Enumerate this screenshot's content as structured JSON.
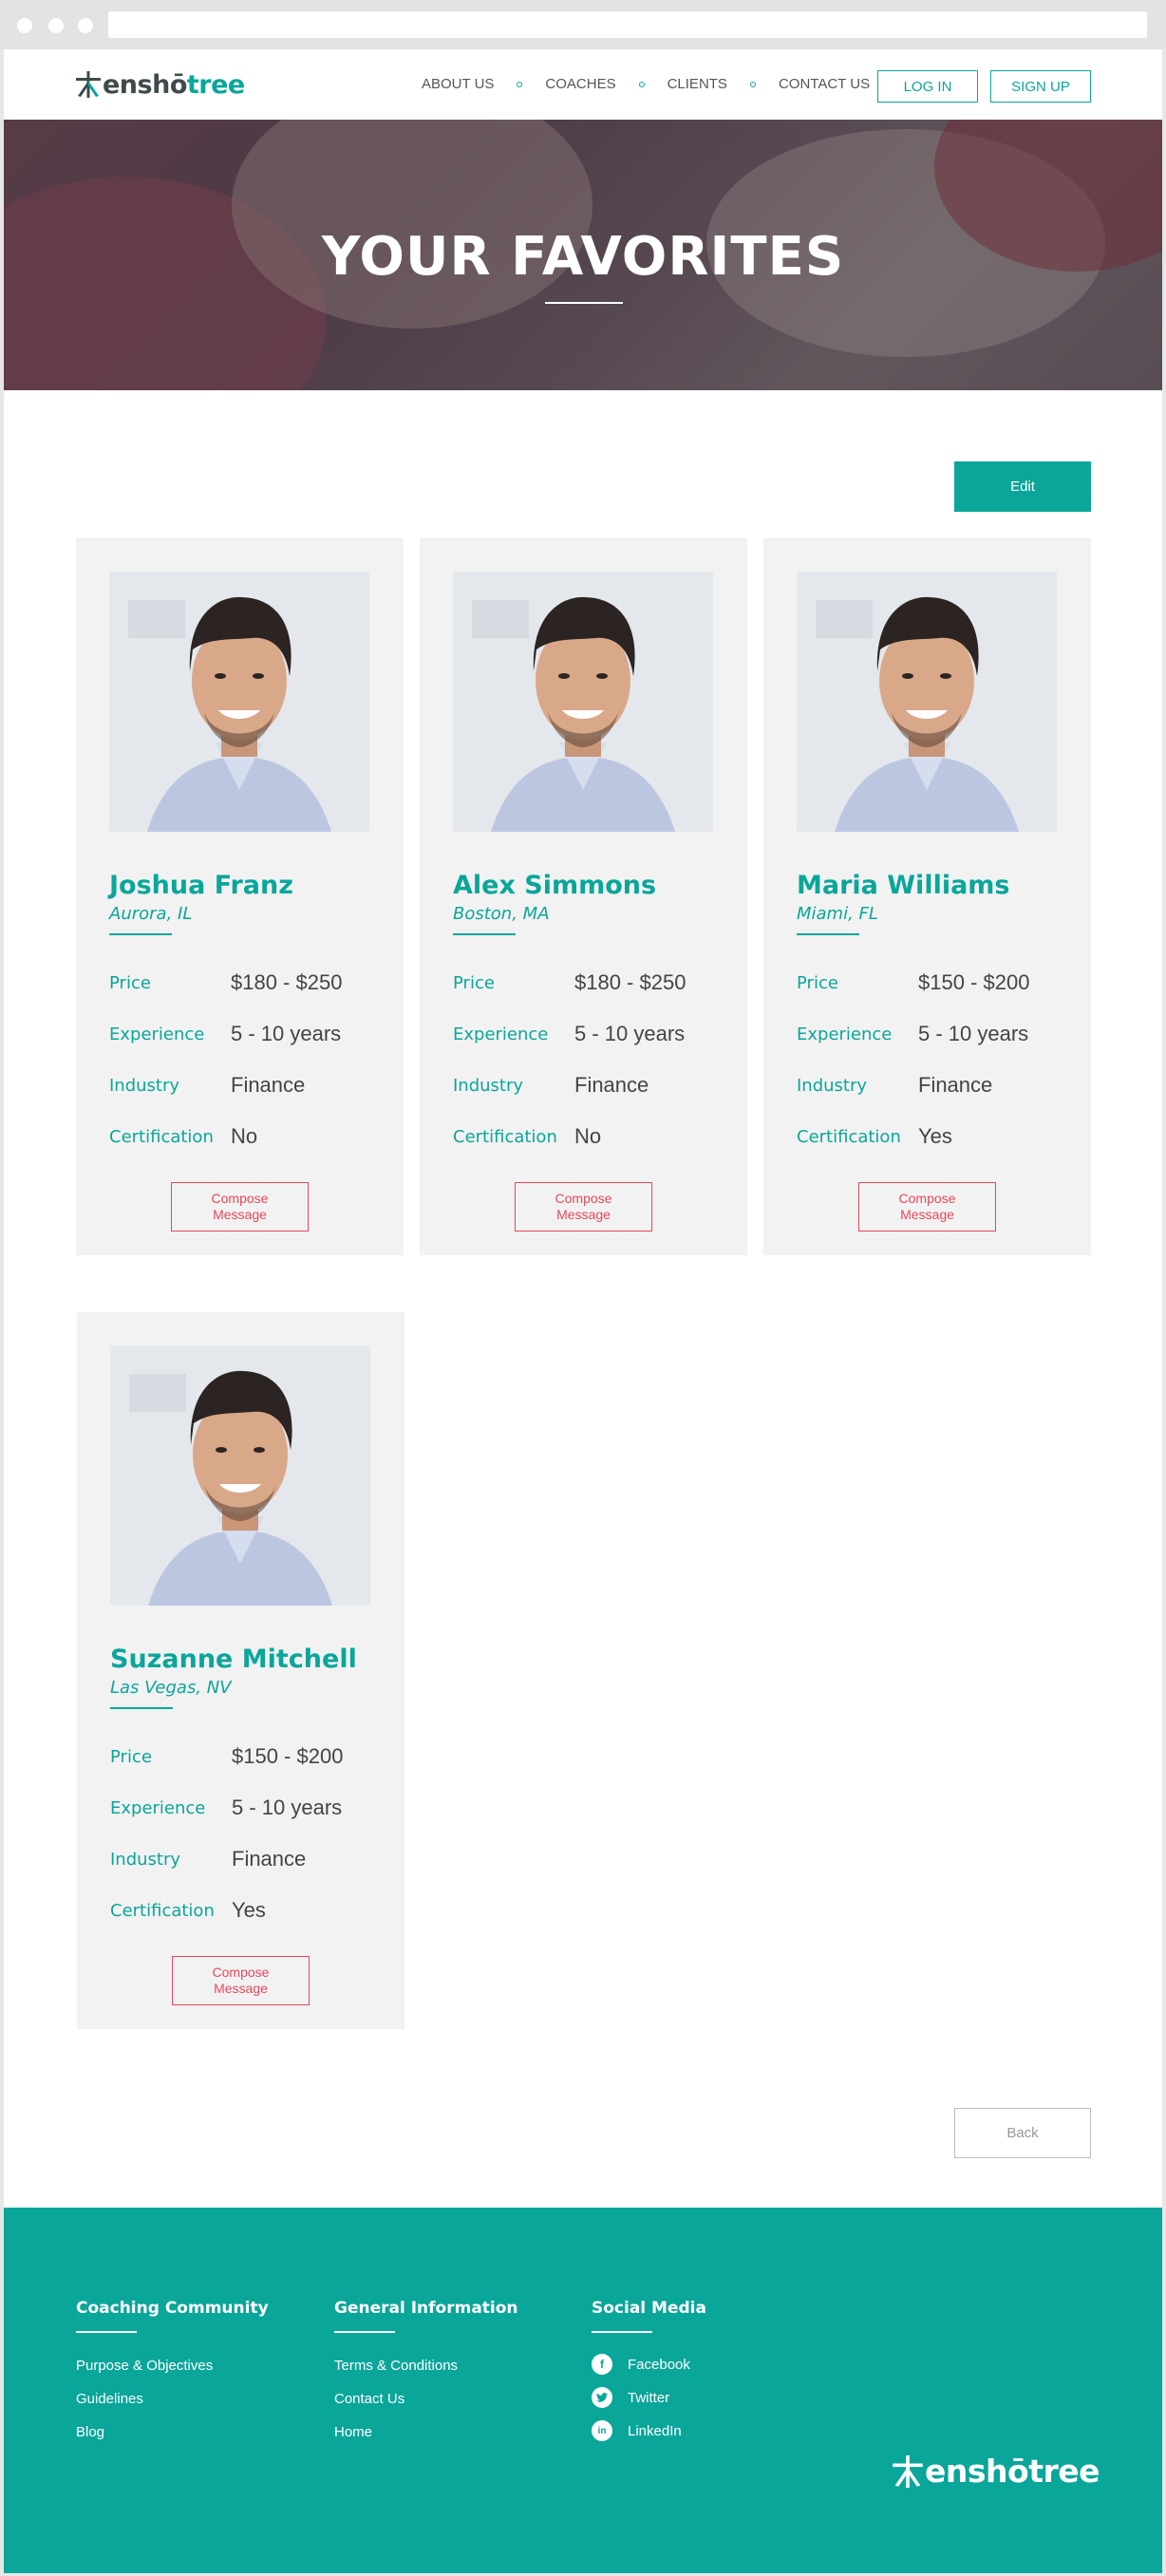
{
  "brand": {
    "name_part1": "enshō",
    "name_part2": "tree",
    "accent_color": "#0aa69a",
    "alert_color": "#e8485a"
  },
  "nav": {
    "items": [
      "ABOUT US",
      "COACHES",
      "CLIENTS",
      "CONTACT US"
    ],
    "login_label": "LOG IN",
    "signup_label": "SIGN UP"
  },
  "hero": {
    "title": "YOUR FAVORITES"
  },
  "actions": {
    "edit_label": "Edit",
    "back_label": "Back"
  },
  "field_labels": {
    "price": "Price",
    "experience": "Experience",
    "industry": "Industry",
    "certification": "Certification"
  },
  "coaches": [
    {
      "name": "Joshua Franz",
      "location": "Aurora, IL",
      "price": "$180 - $250",
      "experience": "5 - 10 years",
      "industry": "Finance",
      "certification": "No",
      "compose_label_1": "Compose",
      "compose_label_2": "Message"
    },
    {
      "name": "Alex Simmons",
      "location": "Boston, MA",
      "price": "$180 - $250",
      "experience": "5 - 10 years",
      "industry": "Finance",
      "certification": "No",
      "compose_label_1": "Compose",
      "compose_label_2": "Message"
    },
    {
      "name": "Maria Williams",
      "location": "Miami, FL",
      "price": "$150 - $200",
      "experience": "5 - 10 years",
      "industry": "Finance",
      "certification": "Yes",
      "compose_label_1": "Compose",
      "compose_label_2": "Message"
    },
    {
      "name": "Suzanne Mitchell",
      "location": "Las Vegas, NV",
      "price": "$150 - $200",
      "experience": "5 - 10 years",
      "industry": "Finance",
      "certification": "Yes",
      "compose_label_1": "Compose",
      "compose_label_2": "Message"
    }
  ],
  "footer": {
    "col1": {
      "heading": "Coaching Community",
      "links": [
        "Purpose & Objectives",
        "Guidelines",
        "Blog"
      ]
    },
    "col2": {
      "heading": "General Information",
      "links": [
        "Terms & Conditions",
        "Contact Us",
        "Home"
      ]
    },
    "col3": {
      "heading": "Social Media",
      "links": [
        "Facebook",
        "Twitter",
        "LinkedIn"
      ],
      "icons": [
        "facebook-icon",
        "twitter-icon",
        "linkedin-icon"
      ]
    }
  }
}
